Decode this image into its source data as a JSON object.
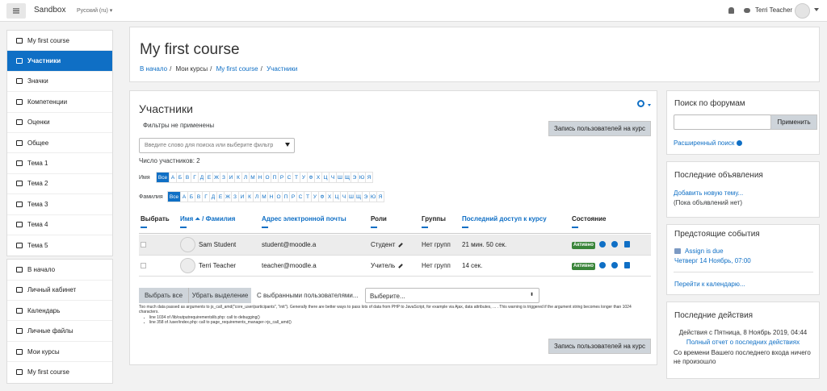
{
  "navbar": {
    "site_name": "Sandbox",
    "language": "Русский (ru) ▾",
    "user_name": "Terri Teacher",
    "icons": [
      "menu-icon",
      "bell-icon",
      "chat-icon",
      "avatar",
      "caret-icon"
    ]
  },
  "sidebar": {
    "group1": [
      {
        "label": "My first course",
        "icon": "graduation-cap-icon"
      },
      {
        "label": "Участники",
        "icon": "users-icon",
        "active": true
      },
      {
        "label": "Значки",
        "icon": "shield-icon"
      },
      {
        "label": "Компетенции",
        "icon": "checkbox-icon"
      },
      {
        "label": "Оценки",
        "icon": "table-icon"
      },
      {
        "label": "Общее",
        "icon": "folder-icon"
      },
      {
        "label": "Тема 1",
        "icon": "folder-icon"
      },
      {
        "label": "Тема 2",
        "icon": "folder-icon"
      },
      {
        "label": "Тема 3",
        "icon": "folder-icon"
      },
      {
        "label": "Тема 4",
        "icon": "folder-icon"
      },
      {
        "label": "Тема 5",
        "icon": "folder-icon"
      }
    ],
    "group2": [
      {
        "label": "В начало",
        "icon": "home-icon"
      },
      {
        "label": "Личный кабинет",
        "icon": "dashboard-icon"
      },
      {
        "label": "Календарь",
        "icon": "calendar-icon"
      },
      {
        "label": "Личные файлы",
        "icon": "file-icon"
      },
      {
        "label": "Мои курсы",
        "icon": "graduation-cap-icon"
      },
      {
        "label": "My first course",
        "icon": "graduation-cap-icon"
      }
    ]
  },
  "course": {
    "title": "My first course",
    "breadcrumb": [
      "В начало",
      "Мои курсы",
      "My first course",
      "Участники"
    ]
  },
  "participants": {
    "title": "Участники",
    "filters_none": "Фильтры не применены",
    "enrol_button": "Запись пользователей на курс",
    "search_placeholder": "Введите слово для поиска или выберите фильтр",
    "count": "Число участников: 2",
    "firstname_label": "Имя",
    "lastname_label": "Фамилия",
    "all": "Все",
    "letters": [
      "А",
      "Б",
      "В",
      "Г",
      "Д",
      "Е",
      "Ж",
      "З",
      "И",
      "К",
      "Л",
      "М",
      "Н",
      "О",
      "П",
      "Р",
      "С",
      "Т",
      "У",
      "Ф",
      "Х",
      "Ц",
      "Ч",
      "Ш",
      "Щ",
      "Э",
      "Ю",
      "Я"
    ],
    "columns": {
      "select": "Выбрать",
      "name": "Имя ⏶ / Фамилия",
      "email": "Адрес электронной почты",
      "roles": "Роли",
      "groups": "Группы",
      "last_access": "Последний доступ к курсу",
      "status": "Состояние"
    },
    "rows": [
      {
        "name": "Sam Student",
        "email": "student@moodle.a",
        "role": "Студент",
        "groups": "Нет групп",
        "last_access": "21 мин. 50 сек.",
        "status": "Активно"
      },
      {
        "name": "Terri Teacher",
        "email": "teacher@moodle.a",
        "role": "Учитель",
        "groups": "Нет групп",
        "last_access": "14 сек.",
        "status": "Активно"
      }
    ],
    "select_all": "Выбрать все",
    "deselect_all": "Убрать выделение",
    "with_selected": "С выбранными пользователями...",
    "choose": "Выберите...",
    "debug_text": "Too much data passed as arguments to js_call_amd(\"core_user/participants\", \"init\"). Generally there are better ways to pass lots of data from PHP to JavaScript, for example via Ajax, data attributes, ... . This warning is triggered if the argument string becomes longer than 1024 characters.",
    "debug_lines": [
      "line 1034 of /lib/outputrequirementslib.php: call to debugging()",
      "line 358 of /user/index.php: call to page_requirements_manager->js_call_amd()"
    ]
  },
  "blocks": {
    "search": {
      "title": "Поиск по форумам",
      "apply": "Применить",
      "advanced": "Расширенный поиск"
    },
    "news": {
      "title": "Последние объявления",
      "add": "Добавить новую тему...",
      "none": "(Пока объявлений нет)"
    },
    "events": {
      "title": "Предстоящие события",
      "event_name": "Assign is due",
      "event_date": "Четверг 14 Ноябрь, 07:00",
      "go_calendar": "Перейти к календарю..."
    },
    "recent": {
      "title": "Последние действия",
      "since": "Действия с Пятница, 8 Ноябрь 2019, 04:44",
      "full_report": "Полный отчет о последних действиях",
      "none": "Со времени Вашего последнего входа ничего не произошло"
    }
  }
}
